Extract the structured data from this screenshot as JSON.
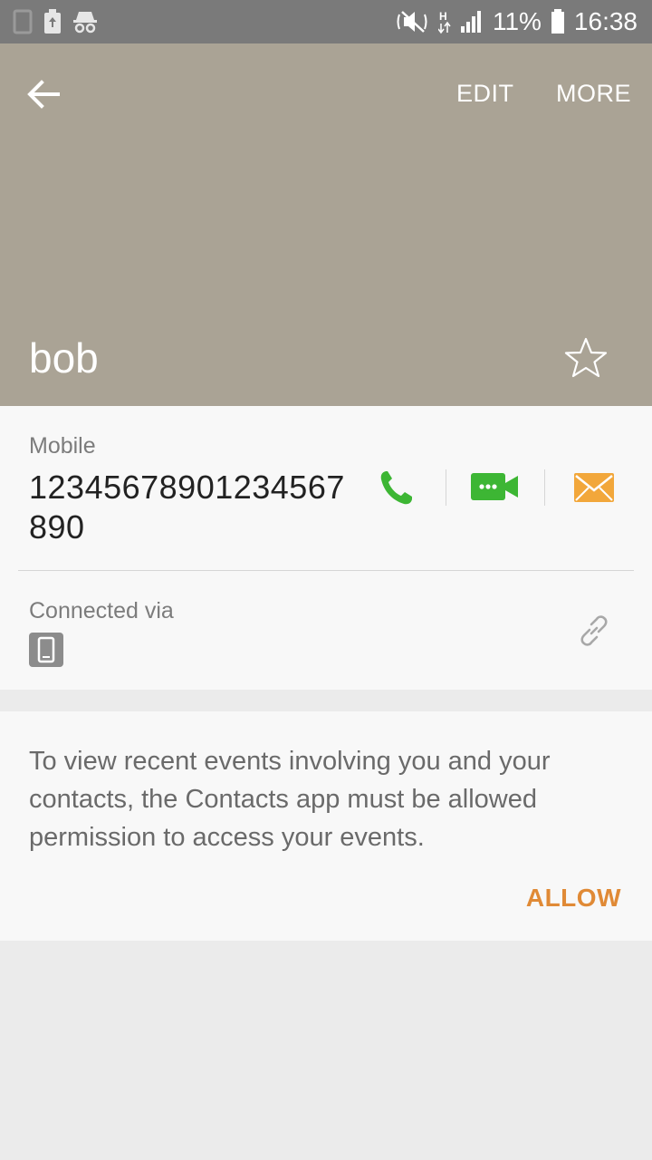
{
  "status_bar": {
    "battery_percent": "11%",
    "time": "16:38",
    "network_type": "H",
    "icons": [
      "sim-icon",
      "battery-saver-icon",
      "incognito-icon",
      "mute-icon",
      "signal-icon",
      "battery-icon"
    ]
  },
  "header": {
    "edit_label": "EDIT",
    "more_label": "MORE",
    "contact_name": "bob",
    "background_color": "#aaa395"
  },
  "phone": {
    "type_label": "Mobile",
    "number": "12345678901234567890",
    "call_color": "#3db634",
    "video_color": "#3db634",
    "message_color": "#f2a73b"
  },
  "connected": {
    "label": "Connected via"
  },
  "permission": {
    "message": "To view recent events involving you and your contacts, the Contacts app must be allowed permission to access your events.",
    "allow_label": "ALLOW",
    "accent_color": "#e08a36"
  }
}
